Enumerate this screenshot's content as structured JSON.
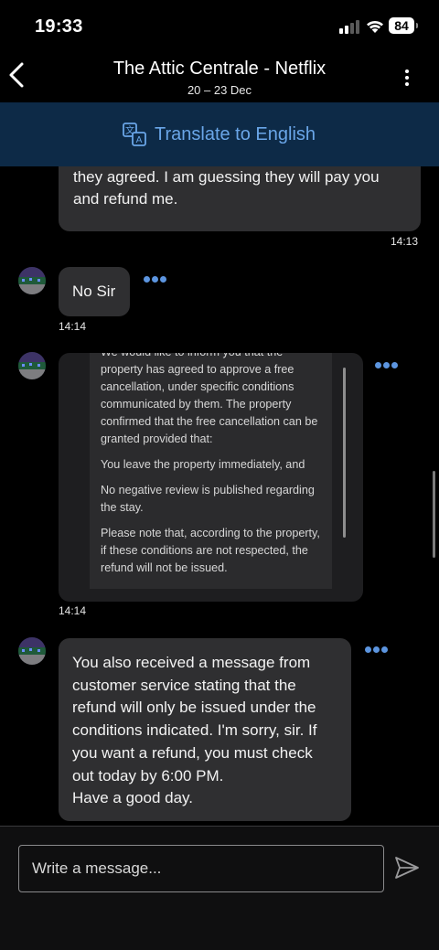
{
  "status_bar": {
    "time": "19:33",
    "battery": "84",
    "icons": [
      "signal-icon",
      "wifi-icon",
      "battery-icon"
    ]
  },
  "header": {
    "title": "The Attic Centrale - Netflix",
    "subtitle": "20 – 23 Dec",
    "back_icon": "chevron-left-icon",
    "menu_icon": "vertical-dots-icon"
  },
  "translate": {
    "label": "Translate to English",
    "icon": "translate-icon",
    "color": "#6aa6e8"
  },
  "messages": [
    {
      "text": "I literally just spoke to them on the phone and\nthey agreed. I am guessing they will pay you\nand refund me.",
      "time": "14:13",
      "sender": "user"
    },
    {
      "text": "No Sir",
      "time": "14:14",
      "sender": "host"
    },
    {
      "type": "embedded",
      "time": "14:14",
      "sender": "host",
      "paragraphs": [
        "We would like to inform you that the property has agreed to approve a free cancellation, under specific conditions communicated by them. The property confirmed that the free cancellation can be granted provided that:",
        "You leave the property immediately, and",
        "No negative review is published regarding the stay.",
        "Please note that, according to the property, if these conditions are not respected, the refund will not be issued."
      ]
    },
    {
      "text": "You also received a message from\ncustomer service stating that the\nrefund will only be issued under the\nconditions indicated. I'm sorry, sir. If\nyou want a refund, you must check\nout today by 6:00 PM.\nHave a good day.",
      "sender": "host"
    }
  ],
  "composer": {
    "placeholder": "Write a message...",
    "send_icon": "send-icon"
  },
  "colors": {
    "background": "#000000",
    "bubble": "#2f2f31",
    "accent": "#5c95e0",
    "translate_bar": "#0d2a47"
  }
}
